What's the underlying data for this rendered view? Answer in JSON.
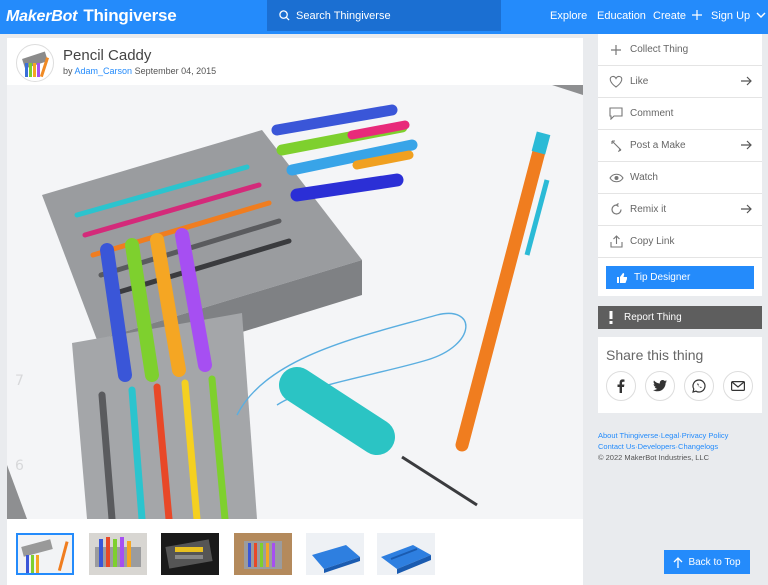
{
  "brand": {
    "maker": "MakerBot",
    "product": "Thingiverse"
  },
  "search": {
    "placeholder": "Search Thingiverse"
  },
  "nav": {
    "explore": "Explore",
    "education": "Education",
    "create": "Create",
    "signup": "Sign Up"
  },
  "thing": {
    "title": "Pencil Caddy",
    "by": "by",
    "author": "Adam_Carson",
    "date": "September 04, 2015"
  },
  "thumbnails_count": 6,
  "actions": [
    {
      "label": "Collect Thing",
      "icon": "plus-icon",
      "arrow": false
    },
    {
      "label": "Like",
      "icon": "heart-icon",
      "arrow": true
    },
    {
      "label": "Comment",
      "icon": "comment-icon",
      "arrow": false
    },
    {
      "label": "Post a Make",
      "icon": "pencil-icon",
      "arrow": true
    },
    {
      "label": "Watch",
      "icon": "eye-icon",
      "arrow": false
    },
    {
      "label": "Remix it",
      "icon": "remix-icon",
      "arrow": true
    },
    {
      "label": "Copy Link",
      "icon": "share-icon",
      "arrow": false
    }
  ],
  "tip": "Tip Designer",
  "report": "Report Thing",
  "share": {
    "title": "Share this thing"
  },
  "footer": {
    "about": "About Thingiverse",
    "sep1": "·",
    "legal": "Legal",
    "sep2": "·",
    "privacy": "Privacy Policy",
    "contact": "Contact Us",
    "sep3": "·",
    "developers": "Developers",
    "sep4": "·",
    "changelogs": "Changelogs",
    "copyright": "©  2022  MakerBot Industries, LLC"
  },
  "back_to_top": "Back to Top",
  "colors": {
    "brand_blue": "#248bfb",
    "search_bg": "#1b6fd2",
    "report_bg": "#5e5e5e"
  }
}
